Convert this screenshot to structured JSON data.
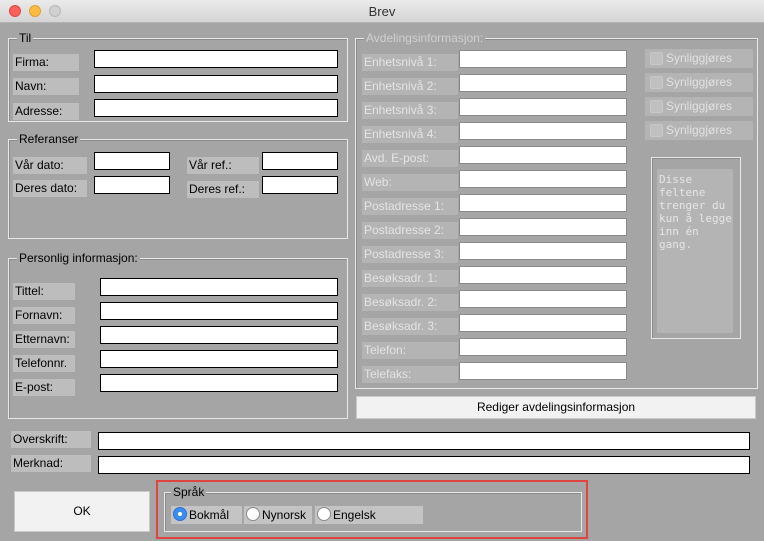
{
  "window": {
    "title": "Brev"
  },
  "til": {
    "legend": "Til",
    "fields": [
      {
        "label": "Firma:",
        "value": ""
      },
      {
        "label": "Navn:",
        "value": ""
      },
      {
        "label": "Adresse:",
        "value": ""
      }
    ]
  },
  "referanser": {
    "legend": "Referanser",
    "var_dato": "Vår dato:",
    "deres_dato": "Deres dato:",
    "var_ref": "Vår ref.:",
    "deres_ref": "Deres ref.:"
  },
  "personlig": {
    "legend": "Personlig informasjon:",
    "fields": [
      {
        "label": "Tittel:"
      },
      {
        "label": "Fornavn:"
      },
      {
        "label": "Etternavn:"
      },
      {
        "label": "Telefonnr."
      },
      {
        "label": "E-post:"
      }
    ]
  },
  "avdeling": {
    "legend": "Avdelingsinformasjon:",
    "fields": [
      {
        "label": "Enhetsnivå 1:"
      },
      {
        "label": "Enhetsnivå 2:"
      },
      {
        "label": "Enhetsnivå 3:"
      },
      {
        "label": "Enhetsnivå 4:"
      },
      {
        "label": "Avd. E-post:"
      },
      {
        "label": "Web:"
      },
      {
        "label": "Postadresse 1:"
      },
      {
        "label": "Postadresse 2:"
      },
      {
        "label": "Postadresse 3:"
      },
      {
        "label": "Besøksadr. 1:"
      },
      {
        "label": "Besøksadr. 2:"
      },
      {
        "label": "Besøksadr. 3:"
      },
      {
        "label": "Telefon:"
      },
      {
        "label": "Telefaks:"
      }
    ],
    "checkbox_label": "Synliggjøres",
    "note": "Disse\nfeltene\ntrenger du\nkun å legge\ninn én\ngang.",
    "edit_button": "Rediger avdelingsinformasjon"
  },
  "overskrift": {
    "label": "Overskrift:",
    "value": ""
  },
  "merknad": {
    "label": "Merknad:",
    "value": ""
  },
  "ok_button": "OK",
  "sprak": {
    "legend": "Språk",
    "options": [
      "Bokmål",
      "Nynorsk",
      "Engelsk"
    ],
    "selected": "Bokmål"
  },
  "colors": {
    "highlight": "#e0443e",
    "radio_selected": "#3b8eed"
  }
}
